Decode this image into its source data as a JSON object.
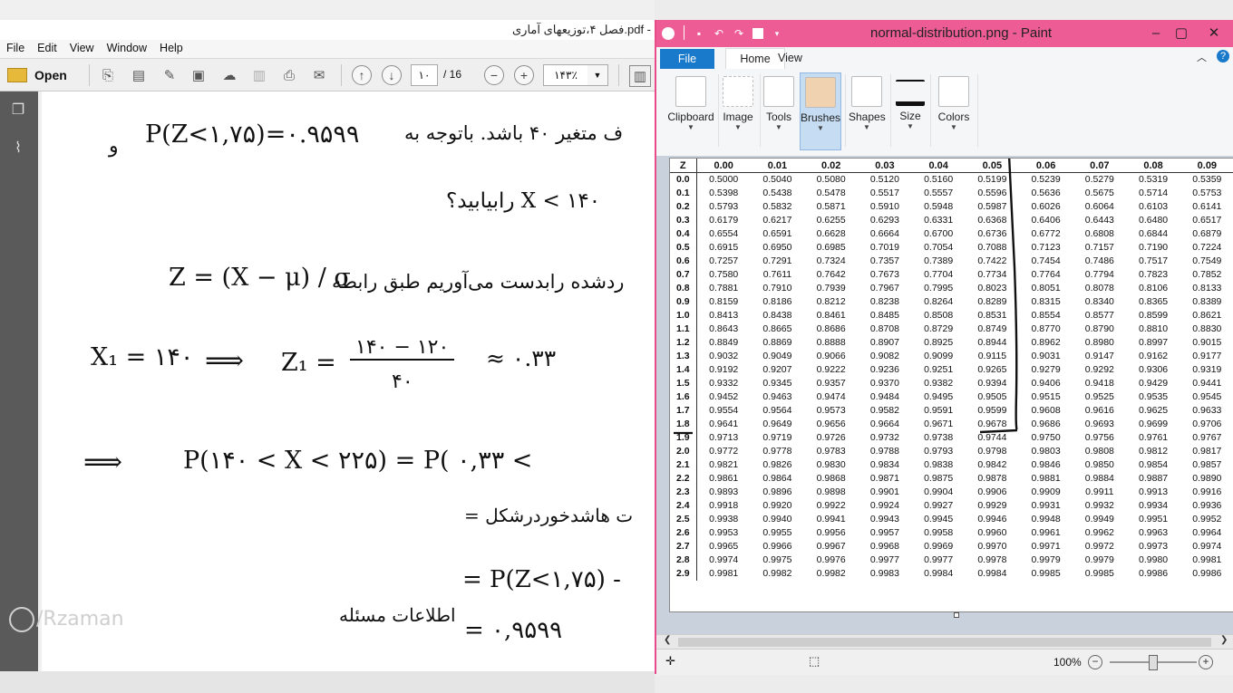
{
  "pdf_viewer": {
    "window_title": "فصل ۴،توزیعهای آماری.pdf -",
    "menu": [
      "File",
      "Edit",
      "View",
      "Window",
      "Help"
    ],
    "toolbar": {
      "open_label": "Open",
      "page_current": "۱۰",
      "page_total": "/ 16",
      "zoom": "۱۴۳٪"
    },
    "handwriting": [
      "P(Z<۱,۷۵)=۰.۹۵۹۹",
      "و",
      "ف متغیر ۴۰ باشد. باتوجه به",
      "X < ۱۴۰ رابیابید؟",
      "Z = (X − μ) / σ",
      "ردشده رابدست می‌آوریم طبق رابطه",
      "X₁ = ۱۴۰",
      "⟹",
      "Z₁ =",
      "۱۴۰ − ۱۲۰",
      "۴۰",
      "≈ ۰.۳۳",
      "⟹",
      "P(۱۴۰ < X < ۲۲۵) = P( ۰,۳۳ <",
      "= ت هاشدخوردرشکل",
      "= P(Z<۱,۷۵) -",
      "اطلاعات مسئله",
      "= ۰,۹۵۹۹"
    ],
    "watermark": "/Rzaman"
  },
  "paint": {
    "window_title": "normal-distribution.png - Paint",
    "tabs": [
      "File",
      "Home",
      "View"
    ],
    "groups": [
      "Clipboard",
      "Image",
      "Tools",
      "Brushes",
      "Shapes",
      "Size",
      "Colors"
    ],
    "selected_group": "Brushes",
    "zoom": "100%"
  },
  "chart_data": {
    "type": "table",
    "columns": [
      "Z",
      "0.00",
      "0.01",
      "0.02",
      "0.03",
      "0.04",
      "0.05",
      "0.06",
      "0.07",
      "0.08",
      "0.09"
    ],
    "rows": [
      [
        "0.0",
        "0.5000",
        "0.5040",
        "0.5080",
        "0.5120",
        "0.5160",
        "0.5199",
        "0.5239",
        "0.5279",
        "0.5319",
        "0.5359"
      ],
      [
        "0.1",
        "0.5398",
        "0.5438",
        "0.5478",
        "0.5517",
        "0.5557",
        "0.5596",
        "0.5636",
        "0.5675",
        "0.5714",
        "0.5753"
      ],
      [
        "0.2",
        "0.5793",
        "0.5832",
        "0.5871",
        "0.5910",
        "0.5948",
        "0.5987",
        "0.6026",
        "0.6064",
        "0.6103",
        "0.6141"
      ],
      [
        "0.3",
        "0.6179",
        "0.6217",
        "0.6255",
        "0.6293",
        "0.6331",
        "0.6368",
        "0.6406",
        "0.6443",
        "0.6480",
        "0.6517"
      ],
      [
        "0.4",
        "0.6554",
        "0.6591",
        "0.6628",
        "0.6664",
        "0.6700",
        "0.6736",
        "0.6772",
        "0.6808",
        "0.6844",
        "0.6879"
      ],
      [
        "0.5",
        "0.6915",
        "0.6950",
        "0.6985",
        "0.7019",
        "0.7054",
        "0.7088",
        "0.7123",
        "0.7157",
        "0.7190",
        "0.7224"
      ],
      [
        "0.6",
        "0.7257",
        "0.7291",
        "0.7324",
        "0.7357",
        "0.7389",
        "0.7422",
        "0.7454",
        "0.7486",
        "0.7517",
        "0.7549"
      ],
      [
        "0.7",
        "0.7580",
        "0.7611",
        "0.7642",
        "0.7673",
        "0.7704",
        "0.7734",
        "0.7764",
        "0.7794",
        "0.7823",
        "0.7852"
      ],
      [
        "0.8",
        "0.7881",
        "0.7910",
        "0.7939",
        "0.7967",
        "0.7995",
        "0.8023",
        "0.8051",
        "0.8078",
        "0.8106",
        "0.8133"
      ],
      [
        "0.9",
        "0.8159",
        "0.8186",
        "0.8212",
        "0.8238",
        "0.8264",
        "0.8289",
        "0.8315",
        "0.8340",
        "0.8365",
        "0.8389"
      ],
      [
        "1.0",
        "0.8413",
        "0.8438",
        "0.8461",
        "0.8485",
        "0.8508",
        "0.8531",
        "0.8554",
        "0.8577",
        "0.8599",
        "0.8621"
      ],
      [
        "1.1",
        "0.8643",
        "0.8665",
        "0.8686",
        "0.8708",
        "0.8729",
        "0.8749",
        "0.8770",
        "0.8790",
        "0.8810",
        "0.8830"
      ],
      [
        "1.2",
        "0.8849",
        "0.8869",
        "0.8888",
        "0.8907",
        "0.8925",
        "0.8944",
        "0.8962",
        "0.8980",
        "0.8997",
        "0.9015"
      ],
      [
        "1.3",
        "0.9032",
        "0.9049",
        "0.9066",
        "0.9082",
        "0.9099",
        "0.9115",
        "0.9031",
        "0.9147",
        "0.9162",
        "0.9177"
      ],
      [
        "1.4",
        "0.9192",
        "0.9207",
        "0.9222",
        "0.9236",
        "0.9251",
        "0.9265",
        "0.9279",
        "0.9292",
        "0.9306",
        "0.9319"
      ],
      [
        "1.5",
        "0.9332",
        "0.9345",
        "0.9357",
        "0.9370",
        "0.9382",
        "0.9394",
        "0.9406",
        "0.9418",
        "0.9429",
        "0.9441"
      ],
      [
        "1.6",
        "0.9452",
        "0.9463",
        "0.9474",
        "0.9484",
        "0.9495",
        "0.9505",
        "0.9515",
        "0.9525",
        "0.9535",
        "0.9545"
      ],
      [
        "1.7",
        "0.9554",
        "0.9564",
        "0.9573",
        "0.9582",
        "0.9591",
        "0.9599",
        "0.9608",
        "0.9616",
        "0.9625",
        "0.9633"
      ],
      [
        "1.8",
        "0.9641",
        "0.9649",
        "0.9656",
        "0.9664",
        "0.9671",
        "0.9678",
        "0.9686",
        "0.9693",
        "0.9699",
        "0.9706"
      ],
      [
        "1.9",
        "0.9713",
        "0.9719",
        "0.9726",
        "0.9732",
        "0.9738",
        "0.9744",
        "0.9750",
        "0.9756",
        "0.9761",
        "0.9767"
      ],
      [
        "2.0",
        "0.9772",
        "0.9778",
        "0.9783",
        "0.9788",
        "0.9793",
        "0.9798",
        "0.9803",
        "0.9808",
        "0.9812",
        "0.9817"
      ],
      [
        "2.1",
        "0.9821",
        "0.9826",
        "0.9830",
        "0.9834",
        "0.9838",
        "0.9842",
        "0.9846",
        "0.9850",
        "0.9854",
        "0.9857"
      ],
      [
        "2.2",
        "0.9861",
        "0.9864",
        "0.9868",
        "0.9871",
        "0.9875",
        "0.9878",
        "0.9881",
        "0.9884",
        "0.9887",
        "0.9890"
      ],
      [
        "2.3",
        "0.9893",
        "0.9896",
        "0.9898",
        "0.9901",
        "0.9904",
        "0.9906",
        "0.9909",
        "0.9911",
        "0.9913",
        "0.9916"
      ],
      [
        "2.4",
        "0.9918",
        "0.9920",
        "0.9922",
        "0.9924",
        "0.9927",
        "0.9929",
        "0.9931",
        "0.9932",
        "0.9934",
        "0.9936"
      ],
      [
        "2.5",
        "0.9938",
        "0.9940",
        "0.9941",
        "0.9943",
        "0.9945",
        "0.9946",
        "0.9948",
        "0.9949",
        "0.9951",
        "0.9952"
      ],
      [
        "2.6",
        "0.9953",
        "0.9955",
        "0.9956",
        "0.9957",
        "0.9958",
        "0.9960",
        "0.9961",
        "0.9962",
        "0.9963",
        "0.9964"
      ],
      [
        "2.7",
        "0.9965",
        "0.9966",
        "0.9967",
        "0.9968",
        "0.9969",
        "0.9970",
        "0.9971",
        "0.9972",
        "0.9973",
        "0.9974"
      ],
      [
        "2.8",
        "0.9974",
        "0.9975",
        "0.9976",
        "0.9977",
        "0.9977",
        "0.9978",
        "0.9979",
        "0.9979",
        "0.9980",
        "0.9981"
      ],
      [
        "2.9",
        "0.9981",
        "0.9982",
        "0.9982",
        "0.9983",
        "0.9984",
        "0.9984",
        "0.9985",
        "0.9985",
        "0.9986",
        "0.9986"
      ]
    ]
  }
}
